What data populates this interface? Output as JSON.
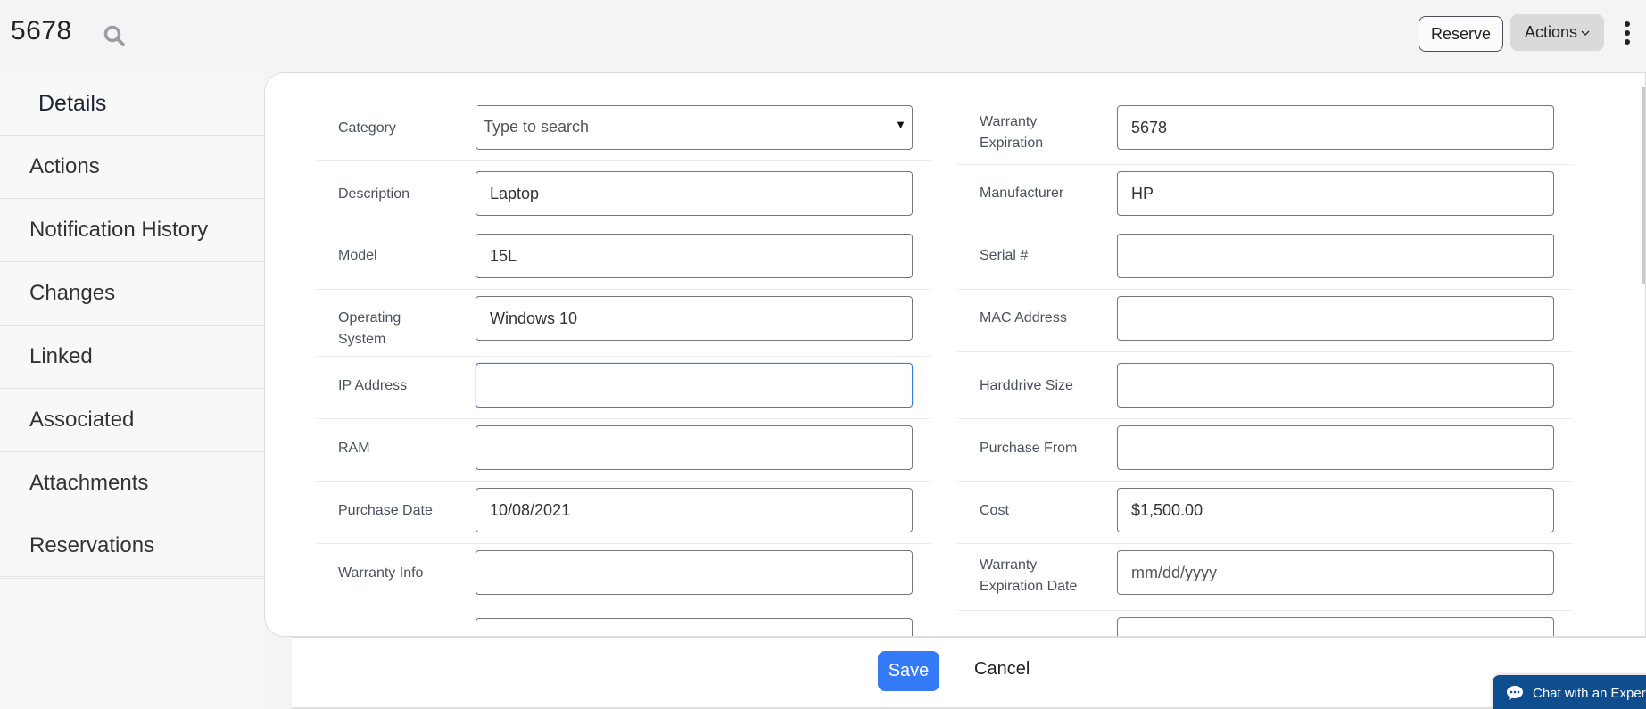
{
  "header": {
    "title": "5678",
    "search_icon": "search-icon",
    "reserve_label": "Reserve",
    "actions_label": "Actions",
    "actions_chevron": "⌄",
    "more_icon": "kebab-vertical-icon"
  },
  "sidebar": {
    "items": [
      {
        "label": "Details",
        "active": true
      },
      {
        "label": "Actions"
      },
      {
        "label": "Notification History"
      },
      {
        "label": "Changes"
      },
      {
        "label": "Linked"
      },
      {
        "label": "Associated"
      },
      {
        "label": "Attachments"
      },
      {
        "label": "Reservations"
      }
    ]
  },
  "form": {
    "left": [
      {
        "label": "Category",
        "type": "select",
        "value": "",
        "placeholder": "Type to search"
      },
      {
        "label": "Description",
        "value": "Laptop",
        "placeholder": ""
      },
      {
        "label": "Model",
        "value": "15L",
        "placeholder": ""
      },
      {
        "label": "Operating System",
        "value": "Windows 10",
        "placeholder": ""
      },
      {
        "label": "IP Address",
        "value": "",
        "placeholder": "",
        "focused": true
      },
      {
        "label": "RAM",
        "value": "",
        "placeholder": ""
      },
      {
        "label": "Purchase Date",
        "value": "10/08/2021",
        "placeholder": ""
      },
      {
        "label": "Warranty Info",
        "value": "",
        "placeholder": ""
      }
    ],
    "right": [
      {
        "label": "Warranty Expiration",
        "value": "5678",
        "placeholder": ""
      },
      {
        "label": "Manufacturer",
        "value": "HP",
        "placeholder": ""
      },
      {
        "label": "Serial #",
        "value": "",
        "placeholder": ""
      },
      {
        "label": "MAC Address",
        "value": "",
        "placeholder": ""
      },
      {
        "label": "Harddrive Size",
        "value": "",
        "placeholder": ""
      },
      {
        "label": "Purchase From",
        "value": "",
        "placeholder": ""
      },
      {
        "label": "Cost",
        "value": "$1,500.00",
        "placeholder": ""
      },
      {
        "label": "Warranty Expiration Date",
        "value": "",
        "placeholder": "mm/dd/yyyy"
      }
    ]
  },
  "footer": {
    "save_label": "Save",
    "cancel_label": "Cancel"
  },
  "chat": {
    "label": "Chat with an Expert"
  },
  "colors": {
    "primary": "#3479f6",
    "chat_bg": "#0e4e8e",
    "focus_border": "#3b7ddd"
  }
}
